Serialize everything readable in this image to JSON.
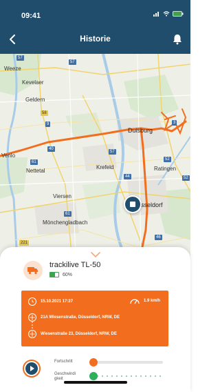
{
  "status_bar": {
    "time": "09:41"
  },
  "header": {
    "title": "Historie"
  },
  "map": {
    "labels": {
      "weeze": "Weeze",
      "kevelaer": "Kevelaer",
      "geldern": "Geldern",
      "duisburg": "Duisburg",
      "venlo": "Venlo",
      "nettetal": "Nettetal",
      "krefeld": "Krefeld",
      "ratingen": "Ratingen",
      "viersen": "Viersen",
      "duesseldorf": "sseldorf",
      "moenchengladbach": "Mönchengladbach"
    },
    "route_numbers": {
      "r57a": "57",
      "r57b": "57",
      "r58": "58",
      "r9": "9",
      "r40": "40",
      "r61": "61",
      "r61b": "61",
      "r52": "52",
      "r52b": "52",
      "r44": "44",
      "r46": "46",
      "r3": "3",
      "r221": "221"
    },
    "route_color": "#f26e1e"
  },
  "device": {
    "name": "trackilive TL-50",
    "battery_label": "60%",
    "battery_level": 0.6
  },
  "trip": {
    "datetime": "15.10.2021 17:27",
    "speed": "1.9 km/h",
    "start_address": "21A Wiesenstraße, Düsseldorf, NRW, DE",
    "end_address": "Wiesenstraße 23, Düsseldorf, NRW, DE"
  },
  "controls": {
    "progress_label": "Fortschritt",
    "speed_label_line1": "Geschwindi",
    "speed_label_line2": "gkeit",
    "progress_value": 0.0,
    "speed_value": 0.0
  },
  "colors": {
    "header": "#1f4d6b",
    "accent": "#f26e1e",
    "battery": "#3fa34d",
    "speed_slider": "#2fae5c"
  }
}
